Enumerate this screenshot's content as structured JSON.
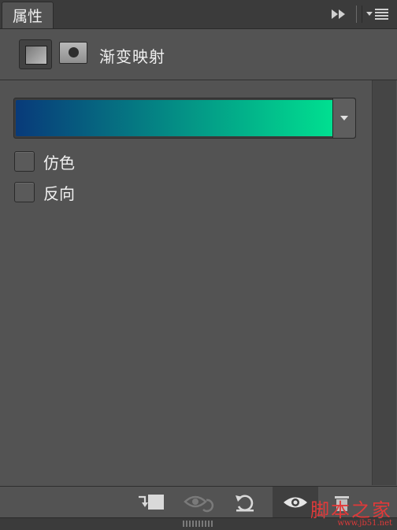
{
  "tab": {
    "label": "属性"
  },
  "header": {
    "title": "渐变映射"
  },
  "gradient": {
    "start_color": "#083a7a",
    "end_color": "#00e090"
  },
  "options": [
    {
      "label": "仿色",
      "checked": false
    },
    {
      "label": "反向",
      "checked": false
    }
  ],
  "footer": {
    "icons": [
      "clip-to-layer-icon",
      "view-previous-state-icon",
      "reset-icon",
      "toggle-visibility-icon",
      "delete-icon"
    ]
  },
  "watermark": {
    "main": "脚本之家",
    "url": "www.jb51.net"
  }
}
